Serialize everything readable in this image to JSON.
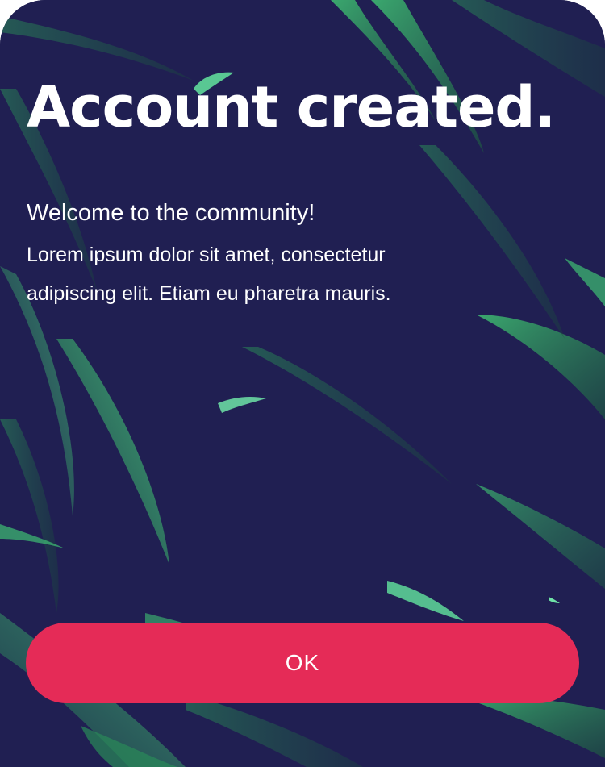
{
  "dialog": {
    "title": "Account created.",
    "welcome": "Welcome to the community!",
    "message": "Lorem ipsum dolor sit amet, consectetur adipiscing elit. Etiam eu pharetra mauris.",
    "ok_label": "OK"
  },
  "colors": {
    "background": "#201f52",
    "leaf_dark": "#1f6b45",
    "leaf_light": "#3fbf73",
    "button": "#e52b57",
    "text": "#ffffff"
  },
  "icons": {
    "background_image": "tropical-leaves-photo"
  }
}
